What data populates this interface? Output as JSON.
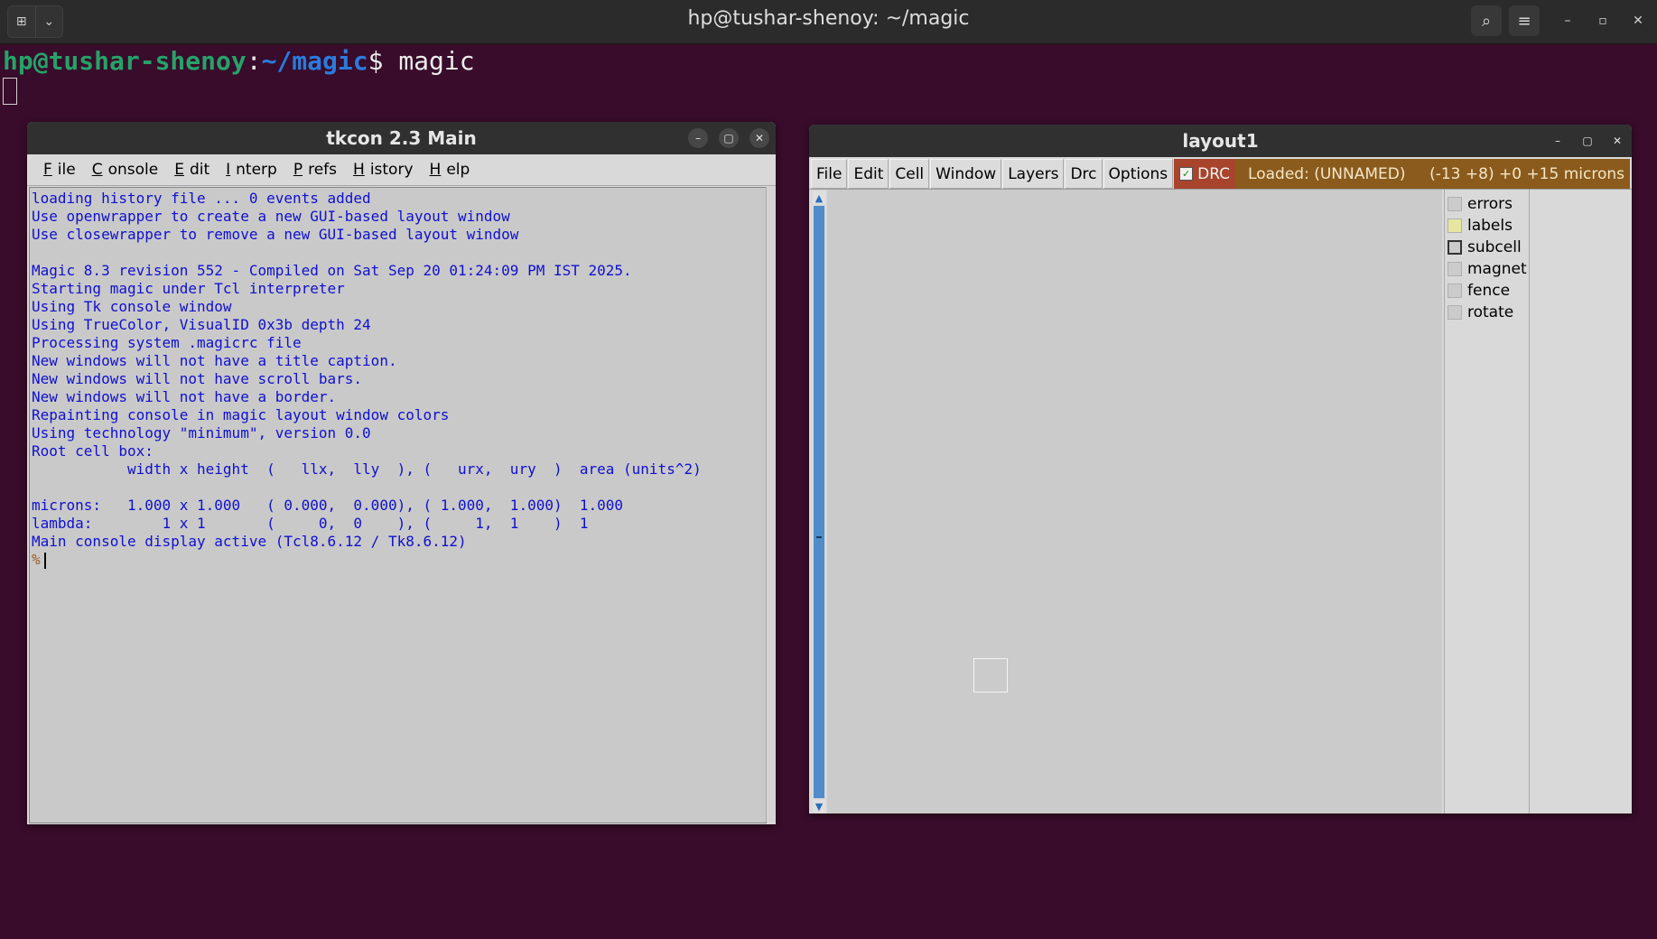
{
  "terminal": {
    "title": "hp@tushar-shenoy: ~/magic",
    "prompt_user": "hp@tushar-shenoy",
    "prompt_colon": ":",
    "prompt_path": "~/magic",
    "prompt_symbol": "$ ",
    "command": "magic"
  },
  "tkcon": {
    "title": "tkcon 2.3 Main",
    "menu": [
      {
        "u": "F",
        "rest": "ile"
      },
      {
        "u": "C",
        "rest": "onsole"
      },
      {
        "u": "E",
        "rest": "dit"
      },
      {
        "u": "I",
        "rest": "nterp"
      },
      {
        "u": "P",
        "rest": "refs"
      },
      {
        "u": "H",
        "rest": "istory"
      },
      {
        "u": "H",
        "rest": "elp"
      }
    ],
    "console_text": "loading history file ... 0 events added\nUse openwrapper to create a new GUI-based layout window\nUse closewrapper to remove a new GUI-based layout window\n\nMagic 8.3 revision 552 - Compiled on Sat Sep 20 01:24:09 PM IST 2025.\nStarting magic under Tcl interpreter\nUsing Tk console window\nUsing TrueColor, VisualID 0x3b depth 24\nProcessing system .magicrc file\nNew windows will not have a title caption.\nNew windows will not have scroll bars.\nNew windows will not have a border.\nRepainting console in magic layout window colors\nUsing technology \"minimum\", version 0.0\nRoot cell box:\n           width x height  (   llx,  lly  ), (   urx,  ury  )  area (units^2)\n\nmicrons:   1.000 x 1.000   ( 0.000,  0.000), ( 1.000,  1.000)  1.000\nlambda:        1 x 1       (     0,  0    ), (     1,  1    )  1\nMain console display active (Tcl8.6.12 / Tk8.6.12)",
    "prompt": "%"
  },
  "layout": {
    "title": "layout1",
    "menu": [
      "File",
      "Edit",
      "Cell",
      "Window",
      "Layers",
      "Drc",
      "Options"
    ],
    "drc_label": "DRC",
    "status_loaded": "Loaded: (UNNAMED)",
    "status_coords": "(-13 +8) +0 +15 microns",
    "layers": [
      {
        "name": "errors",
        "color": "#cbcbcb"
      },
      {
        "name": "labels",
        "color": "#e6e6a0"
      },
      {
        "name": "subcell",
        "color": "#cbcbcb"
      },
      {
        "name": "magnet",
        "color": "#cbcbcb"
      },
      {
        "name": "fence",
        "color": "#cbcbcb"
      },
      {
        "name": "rotate",
        "color": "#cbcbcb"
      }
    ]
  },
  "colors": {
    "desktop": "#380c2a",
    "console_text": "#1010d0",
    "drc_bg": "#a8442c",
    "status_bg": "#8a5b1c",
    "scrollbar": "#4f8cc9"
  }
}
